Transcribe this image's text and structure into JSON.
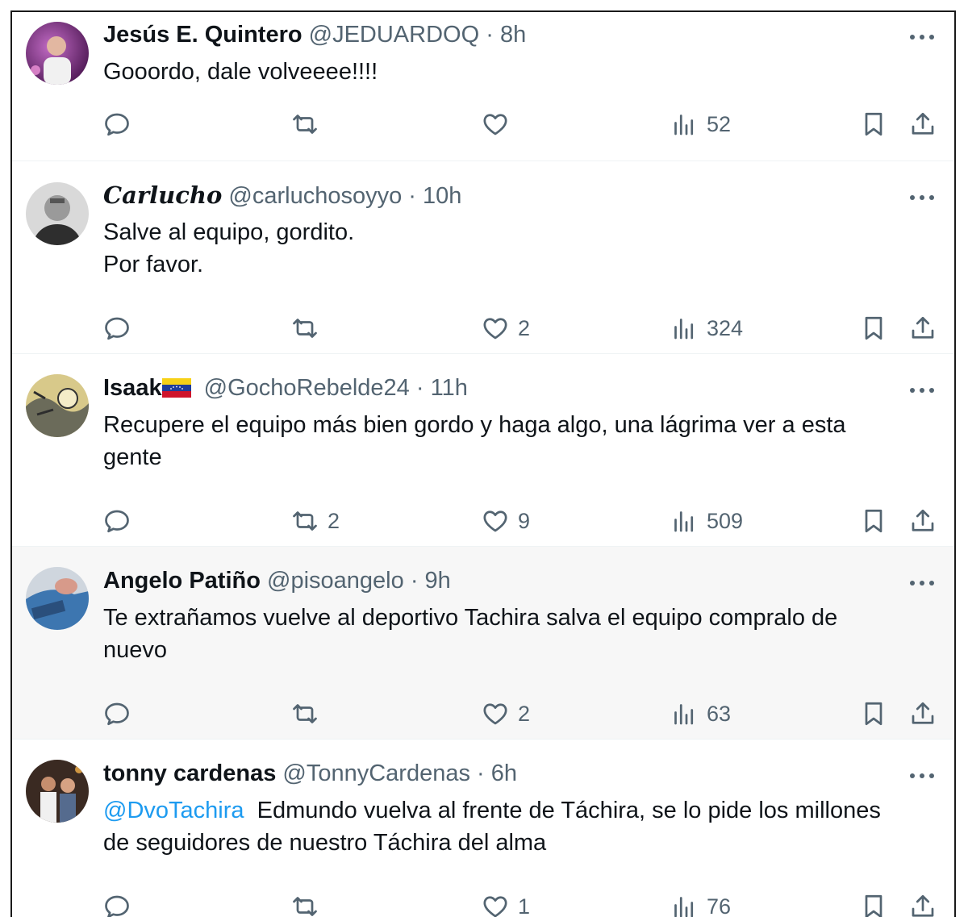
{
  "colors": {
    "text": "#0f1419",
    "secondary": "#536471",
    "link": "#1d9bf0",
    "highlight_bg": "#f7f7f7"
  },
  "tweets": [
    {
      "name": "Jesús E. Quintero",
      "handle": "@JEDUARDOQ",
      "time": "8h",
      "lines": [
        "Gooordo, dale volveeee!!!!"
      ],
      "replies": "",
      "retweets": "",
      "likes": "",
      "views": "52"
    },
    {
      "name": "Carlucho",
      "handle": "@carluchosoyyo",
      "time": "10h",
      "lines": [
        "Salve al equipo, gordito.",
        "Por favor."
      ],
      "replies": "",
      "retweets": "",
      "likes": "2",
      "views": "324"
    },
    {
      "name": "Isaak",
      "handle": "@GochoRebelde24",
      "time": "11h",
      "lines": [
        "Recupere el equipo más bien gordo y haga algo, una lágrima ver a esta",
        "gente"
      ],
      "replies": "",
      "retweets": "2",
      "likes": "9",
      "views": "509"
    },
    {
      "name": "Angelo Patiño",
      "handle": "@pisoangelo",
      "time": "9h",
      "lines": [
        "Te extrañamos vuelve al deportivo Tachira salva el equipo compralo de",
        "nuevo"
      ],
      "replies": "",
      "retweets": "",
      "likes": "2",
      "views": "63"
    },
    {
      "name": "tonny cardenas",
      "handle": "@TonnyCardenas",
      "time": "6h",
      "mention": "@DvoTachira",
      "line1_rest": "Edmundo vuelva al frente de Táchira, se lo pide los millones",
      "line2": "de seguidores de nuestro Táchira del alma",
      "replies": "",
      "retweets": "",
      "likes": "1",
      "views": "76"
    }
  ],
  "separator": "·"
}
